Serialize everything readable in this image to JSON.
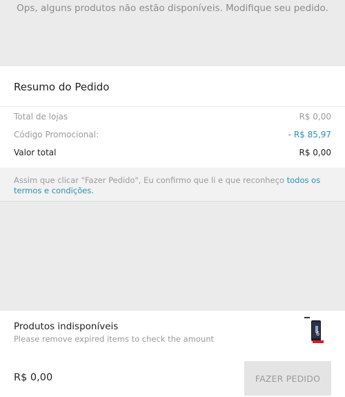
{
  "notice": {
    "message": "Ops, alguns produtos não estão disponíveis. Modifique seu pedido."
  },
  "summary": {
    "title": "Resumo do Pedido",
    "rows": [
      {
        "label": "Total de lojas",
        "value": "R$ 0,00"
      },
      {
        "label": "Código Promocional:",
        "value": "- R$ 85,97"
      },
      {
        "label": "Valor total",
        "value": "R$ 0,00"
      }
    ],
    "promo_color": "#2a8fb8"
  },
  "terms": {
    "text": "Assim que clicar \"Fazer Pedido\", Eu confirmo que li e que reconheço ",
    "link": "todos os termos e condições",
    "suffix": "."
  },
  "unavailable": {
    "title": "Produtos indisponíveis",
    "subtitle": "Please remove expired items to check the amount",
    "product_icon": "phone-box-icon"
  },
  "footer": {
    "price": "R$ 0,00",
    "order_button": "FAZER PEDIDO"
  }
}
